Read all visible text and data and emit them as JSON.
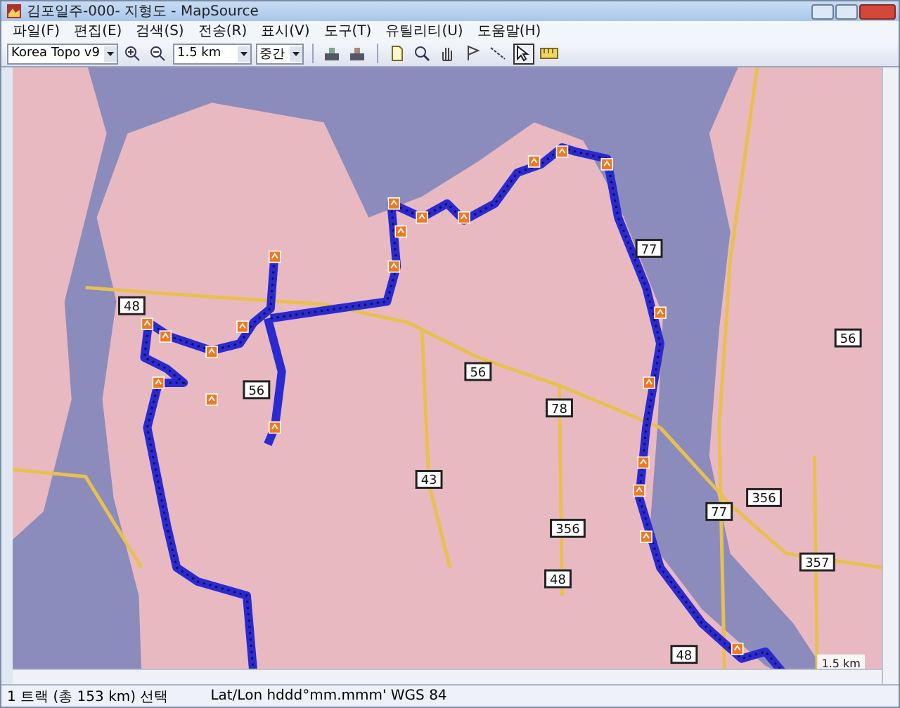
{
  "window": {
    "title": "김포일주-000- 지형도 - MapSource"
  },
  "menu": [
    "파일(F)",
    "편집(E)",
    "검색(S)",
    "전송(R)",
    "표시(V)",
    "도구(T)",
    "유틸리티(U)",
    "도움말(H)"
  ],
  "toolbar": {
    "map_product": "Korea Topo v9",
    "zoom_scale": "1.5 km",
    "detail": "중간"
  },
  "tools": [
    {
      "kind": "select",
      "selected": false
    },
    {
      "kind": "zoom",
      "selected": false
    },
    {
      "kind": "hand",
      "selected": false
    },
    {
      "kind": "pencil",
      "selected": false
    },
    {
      "kind": "route",
      "selected": false
    },
    {
      "kind": "arrow",
      "selected": true
    },
    {
      "kind": "ruler",
      "selected": false
    }
  ],
  "map": {
    "road_shields": [
      "48",
      "56",
      "56",
      "78",
      "43",
      "48",
      "77",
      "77",
      "357",
      "356",
      "356",
      "56",
      "48"
    ],
    "scale": "1.5 km"
  },
  "status_bar": [
    "1 트랙 (총 153 km) 선택",
    "Lat/Lon hddd°mm.mmm' WGS 84"
  ]
}
